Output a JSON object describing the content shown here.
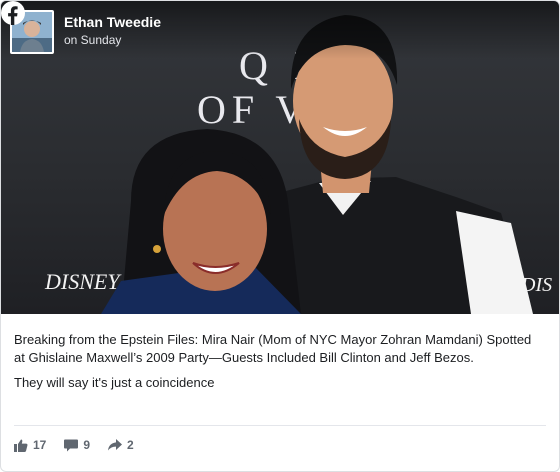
{
  "post": {
    "author": "Ethan Tweedie",
    "timestamp": "on Sunday",
    "platform_icon": "facebook-icon",
    "paragraphs": [
      "Breaking from the Epstein Files: Mira Nair (Mom of NYC Mayor Zohran Mamdani) Spotted at Ghislaine Maxwell’s 2009 Party—Guests Included Bill Clinton and Jeff Bezos.",
      "They will say it's just a coincidence"
    ],
    "photo_backdrop_text": {
      "line1": "Q      N",
      "line2": "OF           VE",
      "logo": "DISNEY",
      "logo_right": "DIS"
    },
    "stats": {
      "likes": "17",
      "comments": "9",
      "shares": "2"
    }
  },
  "colors": {
    "facebook_blue": "#1877f2",
    "text": "#1c1e21",
    "muted": "#606770"
  }
}
